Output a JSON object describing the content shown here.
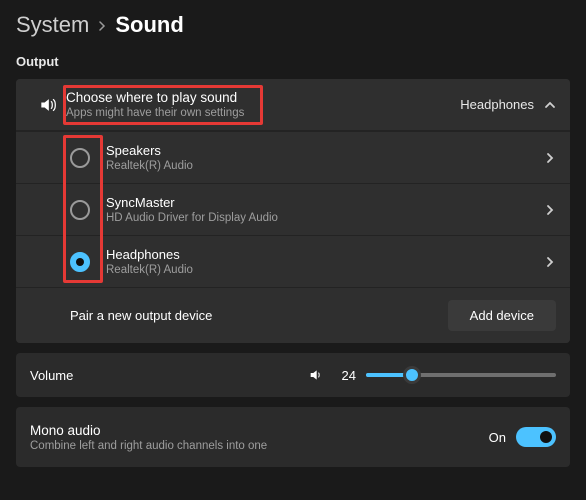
{
  "breadcrumb": {
    "parent": "System",
    "current": "Sound"
  },
  "section": {
    "output_label": "Output"
  },
  "output_section": {
    "choose_title": "Choose where to play sound",
    "choose_sub": "Apps might have their own settings",
    "selected_value": "Headphones",
    "devices": [
      {
        "name": "Speakers",
        "driver": "Realtek(R) Audio",
        "selected": false
      },
      {
        "name": "SyncMaster",
        "driver": "HD Audio Driver for Display Audio",
        "selected": false
      },
      {
        "name": "Headphones",
        "driver": "Realtek(R) Audio",
        "selected": true
      }
    ],
    "pair_label": "Pair a new output device",
    "add_button": "Add device"
  },
  "volume": {
    "label": "Volume",
    "value": 24
  },
  "mono": {
    "title": "Mono audio",
    "sub": "Combine left and right audio channels into one",
    "value_label": "On",
    "on": true
  },
  "annotations": {
    "highlight_choose": true,
    "highlight_radios": true
  },
  "colors": {
    "accent": "#4cc2ff",
    "annotation": "#e53935"
  }
}
